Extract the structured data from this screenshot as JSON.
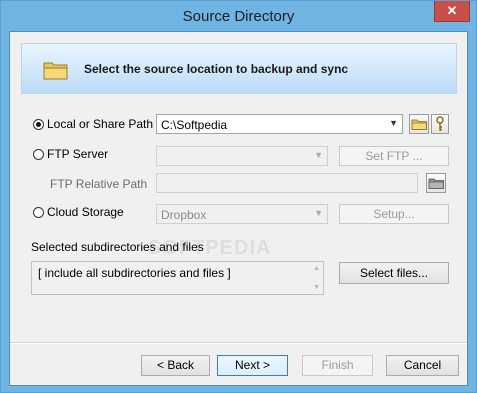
{
  "window": {
    "title": "Source Directory",
    "close_symbol": "✕"
  },
  "banner": {
    "icon": "folder-icon",
    "text": "Select the source location to backup and sync"
  },
  "local": {
    "label": "Local or Share Path",
    "selected": true,
    "path_value": "C:\\Softpedia"
  },
  "ftp": {
    "label": "FTP Server",
    "selected": false,
    "server_value": "",
    "set_button": "Set FTP ...",
    "relative_label": "FTP Relative Path",
    "relative_value": ""
  },
  "cloud": {
    "label": "Cloud Storage",
    "selected": false,
    "provider_value": "Dropbox",
    "setup_button": "Setup..."
  },
  "subdirs": {
    "label": "Selected subdirectories and files",
    "list_text": "[ include all subdirectories and files ]",
    "select_button": "Select files..."
  },
  "footer": {
    "back": "< Back",
    "next": "Next >",
    "finish": "Finish",
    "cancel": "Cancel"
  },
  "watermark": "SOFTPEDIA",
  "colors": {
    "titlebar": "#6fb4e3",
    "close": "#c7504a",
    "banner": "#cfe6fa"
  }
}
